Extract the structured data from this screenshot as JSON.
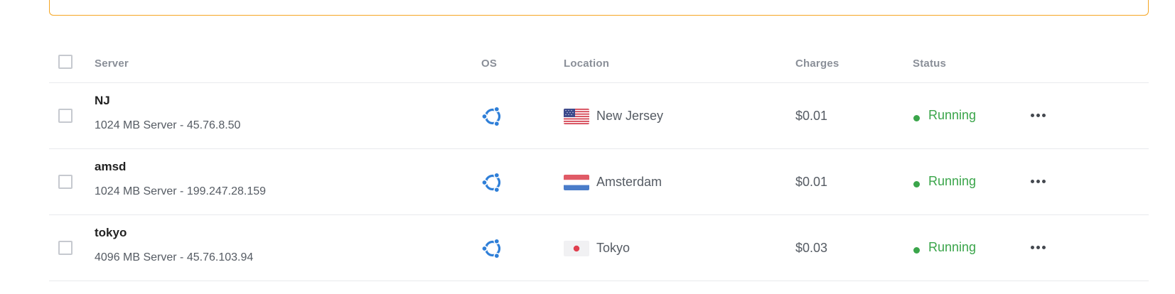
{
  "table": {
    "headers": {
      "server": "Server",
      "os": "OS",
      "location": "Location",
      "charges": "Charges",
      "status": "Status"
    },
    "rows": [
      {
        "name": "NJ",
        "description": "1024 MB Server - 45.76.8.50",
        "os_icon": "ubuntu-icon",
        "location_flag": "us-flag-icon",
        "location": "New Jersey",
        "charges": "$0.01",
        "status": "Running"
      },
      {
        "name": "amsd",
        "description": "1024 MB Server - 199.247.28.159",
        "os_icon": "ubuntu-icon",
        "location_flag": "nl-flag-icon",
        "location": "Amsterdam",
        "charges": "$0.01",
        "status": "Running"
      },
      {
        "name": "tokyo",
        "description": "4096 MB Server - 45.76.103.94",
        "os_icon": "ubuntu-icon",
        "location_flag": "jp-flag-icon",
        "location": "Tokyo",
        "charges": "$0.03",
        "status": "Running"
      }
    ]
  },
  "colors": {
    "alert_border": "#f5a623",
    "status_running": "#3aa54a",
    "os_icon": "#2f7fd8"
  }
}
